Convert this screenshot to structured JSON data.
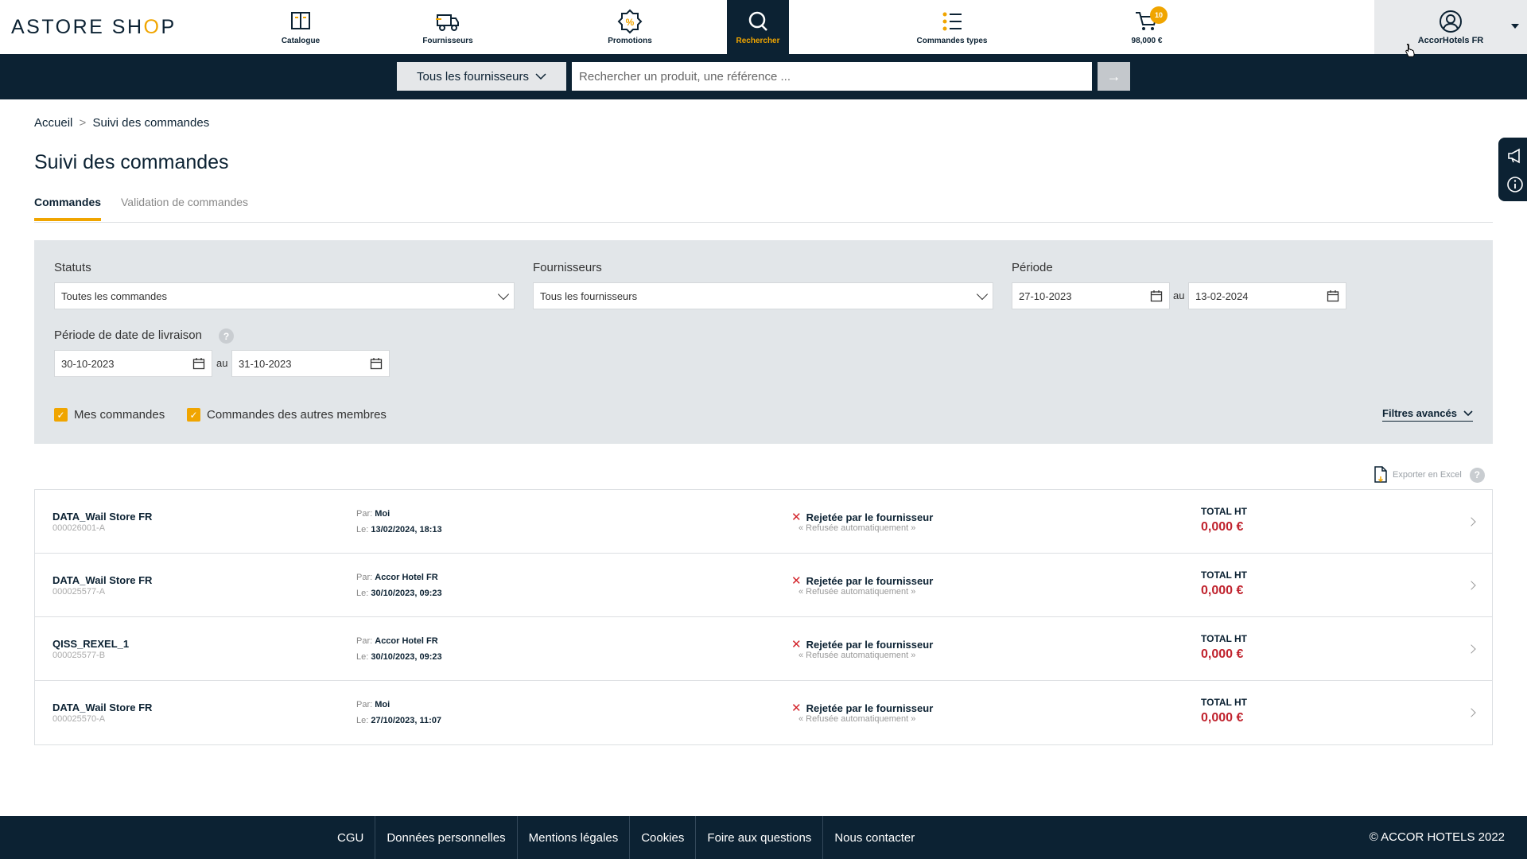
{
  "brand": {
    "logo_text_1": "ASTORE SH",
    "logo_o": "O",
    "logo_text_2": "P"
  },
  "nav": {
    "catalogue": "Catalogue",
    "fournisseurs": "Fournisseurs",
    "promotions": "Promotions",
    "rechercher": "Rechercher",
    "commandes_types": "Commandes types",
    "cart_amount": "98,000 €",
    "cart_count": "10",
    "account": "AccorHotels FR"
  },
  "search": {
    "supplier_select": "Tous les fournisseurs",
    "placeholder": "Rechercher un produit, une référence ...",
    "button": "→"
  },
  "breadcrumb": {
    "home": "Accueil",
    "separator": ">",
    "current": "Suivi des commandes"
  },
  "page_title": "Suivi des commandes",
  "tabs": {
    "commandes": "Commandes",
    "validation": "Validation de commandes"
  },
  "filters": {
    "statuts_label": "Statuts",
    "statuts_value": "Toutes les commandes",
    "fournisseurs_label": "Fournisseurs",
    "fournisseurs_value": "Tous les fournisseurs",
    "periode_label": "Période",
    "periode_from": "27-10-2023",
    "periode_to": "13-02-2024",
    "au": "au",
    "livraison_label": "Période de date de livraison",
    "livraison_from": "30-10-2023",
    "livraison_to": "31-10-2023",
    "help": "?",
    "mes_commandes": "Mes commandes",
    "autres_membres": "Commandes des autres membres",
    "check": "✓",
    "advanced": "Filtres avancés"
  },
  "export": {
    "label": "Exporter en Excel",
    "help": "?"
  },
  "orders": [
    {
      "store": "DATA_Wail Store FR",
      "ref": "000026001-A",
      "par_label": "Par:",
      "par": "Moi",
      "le_label": "Le:",
      "date": "13/02/2024, 18:13",
      "status": "Rejetée par le fournisseur",
      "note": "« Refusée automatiquement »",
      "total_label": "TOTAL HT",
      "amount": "0,000 €"
    },
    {
      "store": "DATA_Wail Store FR",
      "ref": "000025577-A",
      "par_label": "Par:",
      "par": "Accor Hotel FR",
      "le_label": "Le:",
      "date": "30/10/2023, 09:23",
      "status": "Rejetée par le fournisseur",
      "note": "« Refusée automatiquement »",
      "total_label": "TOTAL HT",
      "amount": "0,000 €"
    },
    {
      "store": "QISS_REXEL_1",
      "ref": "000025577-B",
      "par_label": "Par:",
      "par": "Accor Hotel FR",
      "le_label": "Le:",
      "date": "30/10/2023, 09:23",
      "status": "Rejetée par le fournisseur",
      "note": "« Refusée automatiquement »",
      "total_label": "TOTAL HT",
      "amount": "0,000 €"
    },
    {
      "store": "DATA_Wail Store FR",
      "ref": "000025570-A",
      "par_label": "Par:",
      "par": "Moi",
      "le_label": "Le:",
      "date": "27/10/2023, 11:07",
      "status": "Rejetée par le fournisseur",
      "note": "« Refusée automatiquement »",
      "total_label": "TOTAL HT",
      "amount": "0,000 €"
    }
  ],
  "footer": {
    "links": [
      "CGU",
      "Données personnelles",
      "Mentions légales",
      "Cookies",
      "Foire aux questions",
      "Nous contacter"
    ],
    "copyright": "© ACCOR HOTELS 2022"
  },
  "colors": {
    "navy": "#0c2233",
    "accent": "#f0a500",
    "danger": "#c0232e",
    "filter_bg": "#e2e6e9"
  }
}
